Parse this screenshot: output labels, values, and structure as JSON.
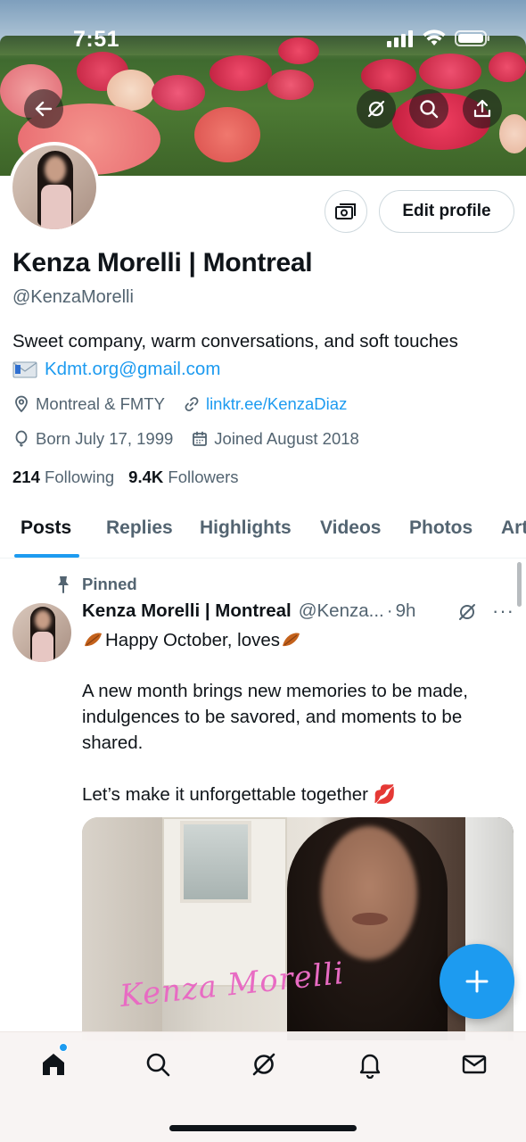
{
  "status_bar": {
    "time": "7:51"
  },
  "header_actions": {
    "back_icon": "arrow-left-icon",
    "grok_icon": "grok-icon",
    "search_icon": "search-icon",
    "share_icon": "share-icon"
  },
  "profile": {
    "display_name": "Kenza Morelli | Montreal",
    "handle": "@KenzaMorelli",
    "bio_line1": "Sweet company, warm conversations, and soft touches",
    "bio_email": "Kdmt.org@gmail.com",
    "location": "Montreal & FMTY",
    "website": "linktr.ee/KenzaDiaz",
    "born": "Born July 17, 1999",
    "joined": "Joined August 2018",
    "following_count": "214",
    "following_label": "Following",
    "followers_count": "9.4K",
    "followers_label": "Followers",
    "edit_profile_label": "Edit profile"
  },
  "tabs": [
    {
      "label": "Posts",
      "active": true
    },
    {
      "label": "Replies",
      "active": false
    },
    {
      "label": "Highlights",
      "active": false
    },
    {
      "label": "Videos",
      "active": false
    },
    {
      "label": "Photos",
      "active": false
    },
    {
      "label": "Art",
      "active": false
    }
  ],
  "tweet": {
    "pinned_label": "Pinned",
    "author_name": "Kenza Morelli | Montreal",
    "author_handle": "@Kenza...",
    "separator": "·",
    "time": "9h",
    "more": "···",
    "line1": "Happy October, loves",
    "paragraph2": "A new month brings new memories to be made, indulgences to be savored, and moments to be shared.",
    "paragraph3": "Let’s make it unforgettable together",
    "kiss_emoji": "💋",
    "media_signature": "Kenza Morelli"
  },
  "colors": {
    "accent": "#1d9bf0",
    "text_primary": "#0f1419",
    "text_secondary": "#536471"
  },
  "bottom_nav": [
    {
      "name": "home",
      "icon": "home-icon"
    },
    {
      "name": "search",
      "icon": "search-icon"
    },
    {
      "name": "grok",
      "icon": "grok-icon"
    },
    {
      "name": "notifications",
      "icon": "bell-icon"
    },
    {
      "name": "messages",
      "icon": "mail-icon"
    }
  ]
}
